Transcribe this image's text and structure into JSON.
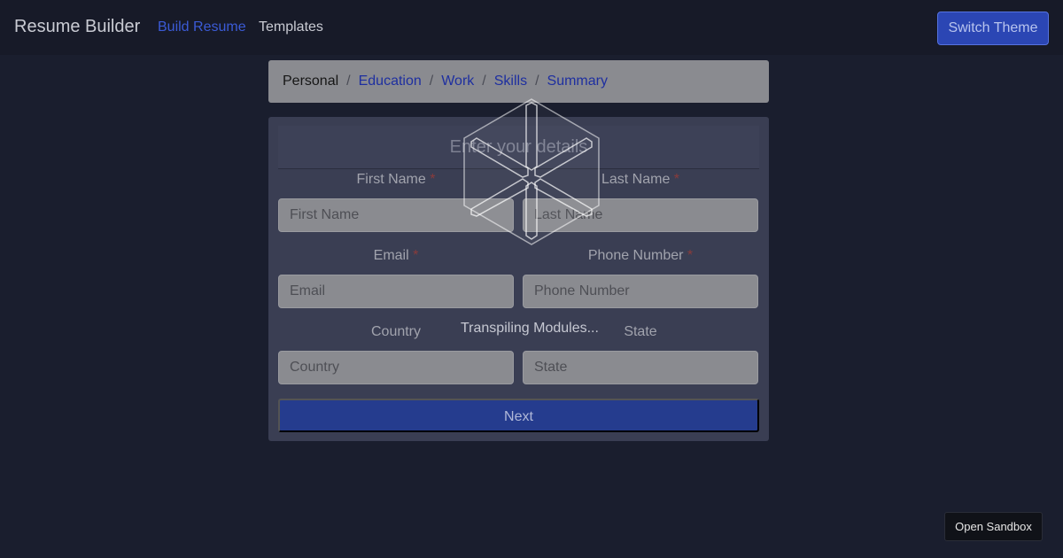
{
  "navbar": {
    "brand": "Resume Builder",
    "links": [
      {
        "label": "Build Resume"
      },
      {
        "label": "Templates"
      }
    ],
    "theme_button": "Switch Theme"
  },
  "breadcrumb": {
    "items": [
      "Personal",
      "Education",
      "Work",
      "Skills",
      "Summary"
    ],
    "separator": "/"
  },
  "form": {
    "title": "Enter your details",
    "required_marker": "*",
    "fields": {
      "first_name": {
        "label": "First Name",
        "placeholder": "First Name",
        "required": true
      },
      "last_name": {
        "label": "Last Name",
        "placeholder": "Last Name",
        "required": true
      },
      "email": {
        "label": "Email",
        "placeholder": "Email",
        "required": true
      },
      "phone": {
        "label": "Phone Number",
        "placeholder": "Phone Number",
        "required": true
      },
      "country": {
        "label": "Country",
        "placeholder": "Country",
        "required": false
      },
      "state": {
        "label": "State",
        "placeholder": "State",
        "required": false
      }
    },
    "next_button": "Next"
  },
  "loader": {
    "icon": "cube-icon",
    "text": "Transpiling Modules..."
  },
  "sandbox_button": "Open Sandbox",
  "colors": {
    "background": "#1a1e2e",
    "accent": "#3b5bd6",
    "primary_button": "#253c8e"
  }
}
